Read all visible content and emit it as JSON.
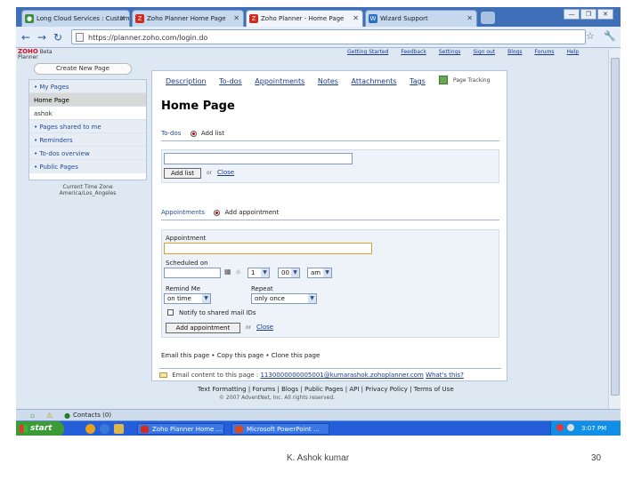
{
  "browser": {
    "tabs": [
      {
        "label": "Long Cloud Services : Custom",
        "icon_color": "#3c8d40",
        "icon": "globe-icon"
      },
      {
        "label": "Zoho Planner Home Page",
        "icon_color": "#d12b1f",
        "icon": "zoho-icon"
      },
      {
        "label": "Zoho Planner - Home Page",
        "icon_color": "#d12b1f",
        "icon": "zoho-icon"
      },
      {
        "label": "Wizard Support",
        "icon_color": "#2a6ebf",
        "icon": "wizard-icon"
      }
    ],
    "window_buttons": [
      "—",
      "❐",
      "✕"
    ],
    "url": "https://planner.zoho.com/login.do",
    "nav_icons": {
      "back": "←",
      "forward": "→",
      "reload": "↻",
      "star": "☆",
      "wrench": "🔧"
    }
  },
  "app": {
    "logo_brand": "ZOHO",
    "logo_beta": "Beta",
    "logo_name": "Planner",
    "top_links": [
      "Getting Started",
      "Feedback",
      "Settings",
      "Sign out",
      "Blogs",
      "Forums",
      "Help"
    ],
    "create_page_label": "Create New Page",
    "sidebar": {
      "items": [
        {
          "label": "• My Pages",
          "style": "head"
        },
        {
          "label": "Home Page",
          "style": "sel"
        },
        {
          "label": "ashok",
          "style": "plain"
        },
        {
          "label": "•  Pages shared to me",
          "style": "head"
        },
        {
          "label": "•  Reminders",
          "style": "head"
        },
        {
          "label": "•  To-dos overview",
          "style": "head"
        },
        {
          "label": "•  Public Pages",
          "style": "head"
        }
      ]
    },
    "timezone": {
      "label": "Current Time Zone",
      "value": "America/Los_Angeles"
    },
    "main": {
      "tabs": [
        "Description",
        "To-dos",
        "Appointments",
        "Notes",
        "Attachments",
        "Tags"
      ],
      "tag_label": "Page Tracking",
      "title": "Home Page",
      "todos": {
        "section_label": "To-dos",
        "option_label": "Add list",
        "add_button": "Add list",
        "or": "or",
        "close_link": "Close"
      },
      "appointments": {
        "section_label": "Appointments",
        "option_label": "Add appointment",
        "appointment_label": "Appointment",
        "scheduled_label": "Scheduled on",
        "hour": "1",
        "minute": "00",
        "ampm": "am",
        "remind_label": "Remind Me",
        "remind_value": "on time",
        "repeat_label": "Repeat",
        "repeat_value": "only once",
        "notify_label": "Notify to shared mail IDs",
        "add_button": "Add appointment",
        "or": "or",
        "close_link": "Close"
      },
      "footer_actions": "Email this page  •  Copy this page  •  Clone this page",
      "email_prefix": "Email content to this page :",
      "email_address": "1130000000005001@kumarashok.zohoplanner.com",
      "email_suffix": "What's this?"
    },
    "bottom_links": "Text Formatting  |  Forums  |  Blogs  |  Public Pages  |  API  |  Privacy Policy  |  Terms of Use",
    "copyright": "© 2007 AdventNet, Inc. All rights reserved."
  },
  "downloads_bar": {
    "label": "Contacts (0)"
  },
  "taskbar": {
    "start_label": "start",
    "tasks": [
      {
        "label": "Zoho Planner Home ...",
        "icon_color": "#d12b1f"
      },
      {
        "label": "Microsoft PowerPoint ...",
        "icon_color": "#d84a1b"
      }
    ],
    "clock": "3:07 PM"
  },
  "slide": {
    "author": "K. Ashok kumar",
    "page_number": "30"
  }
}
